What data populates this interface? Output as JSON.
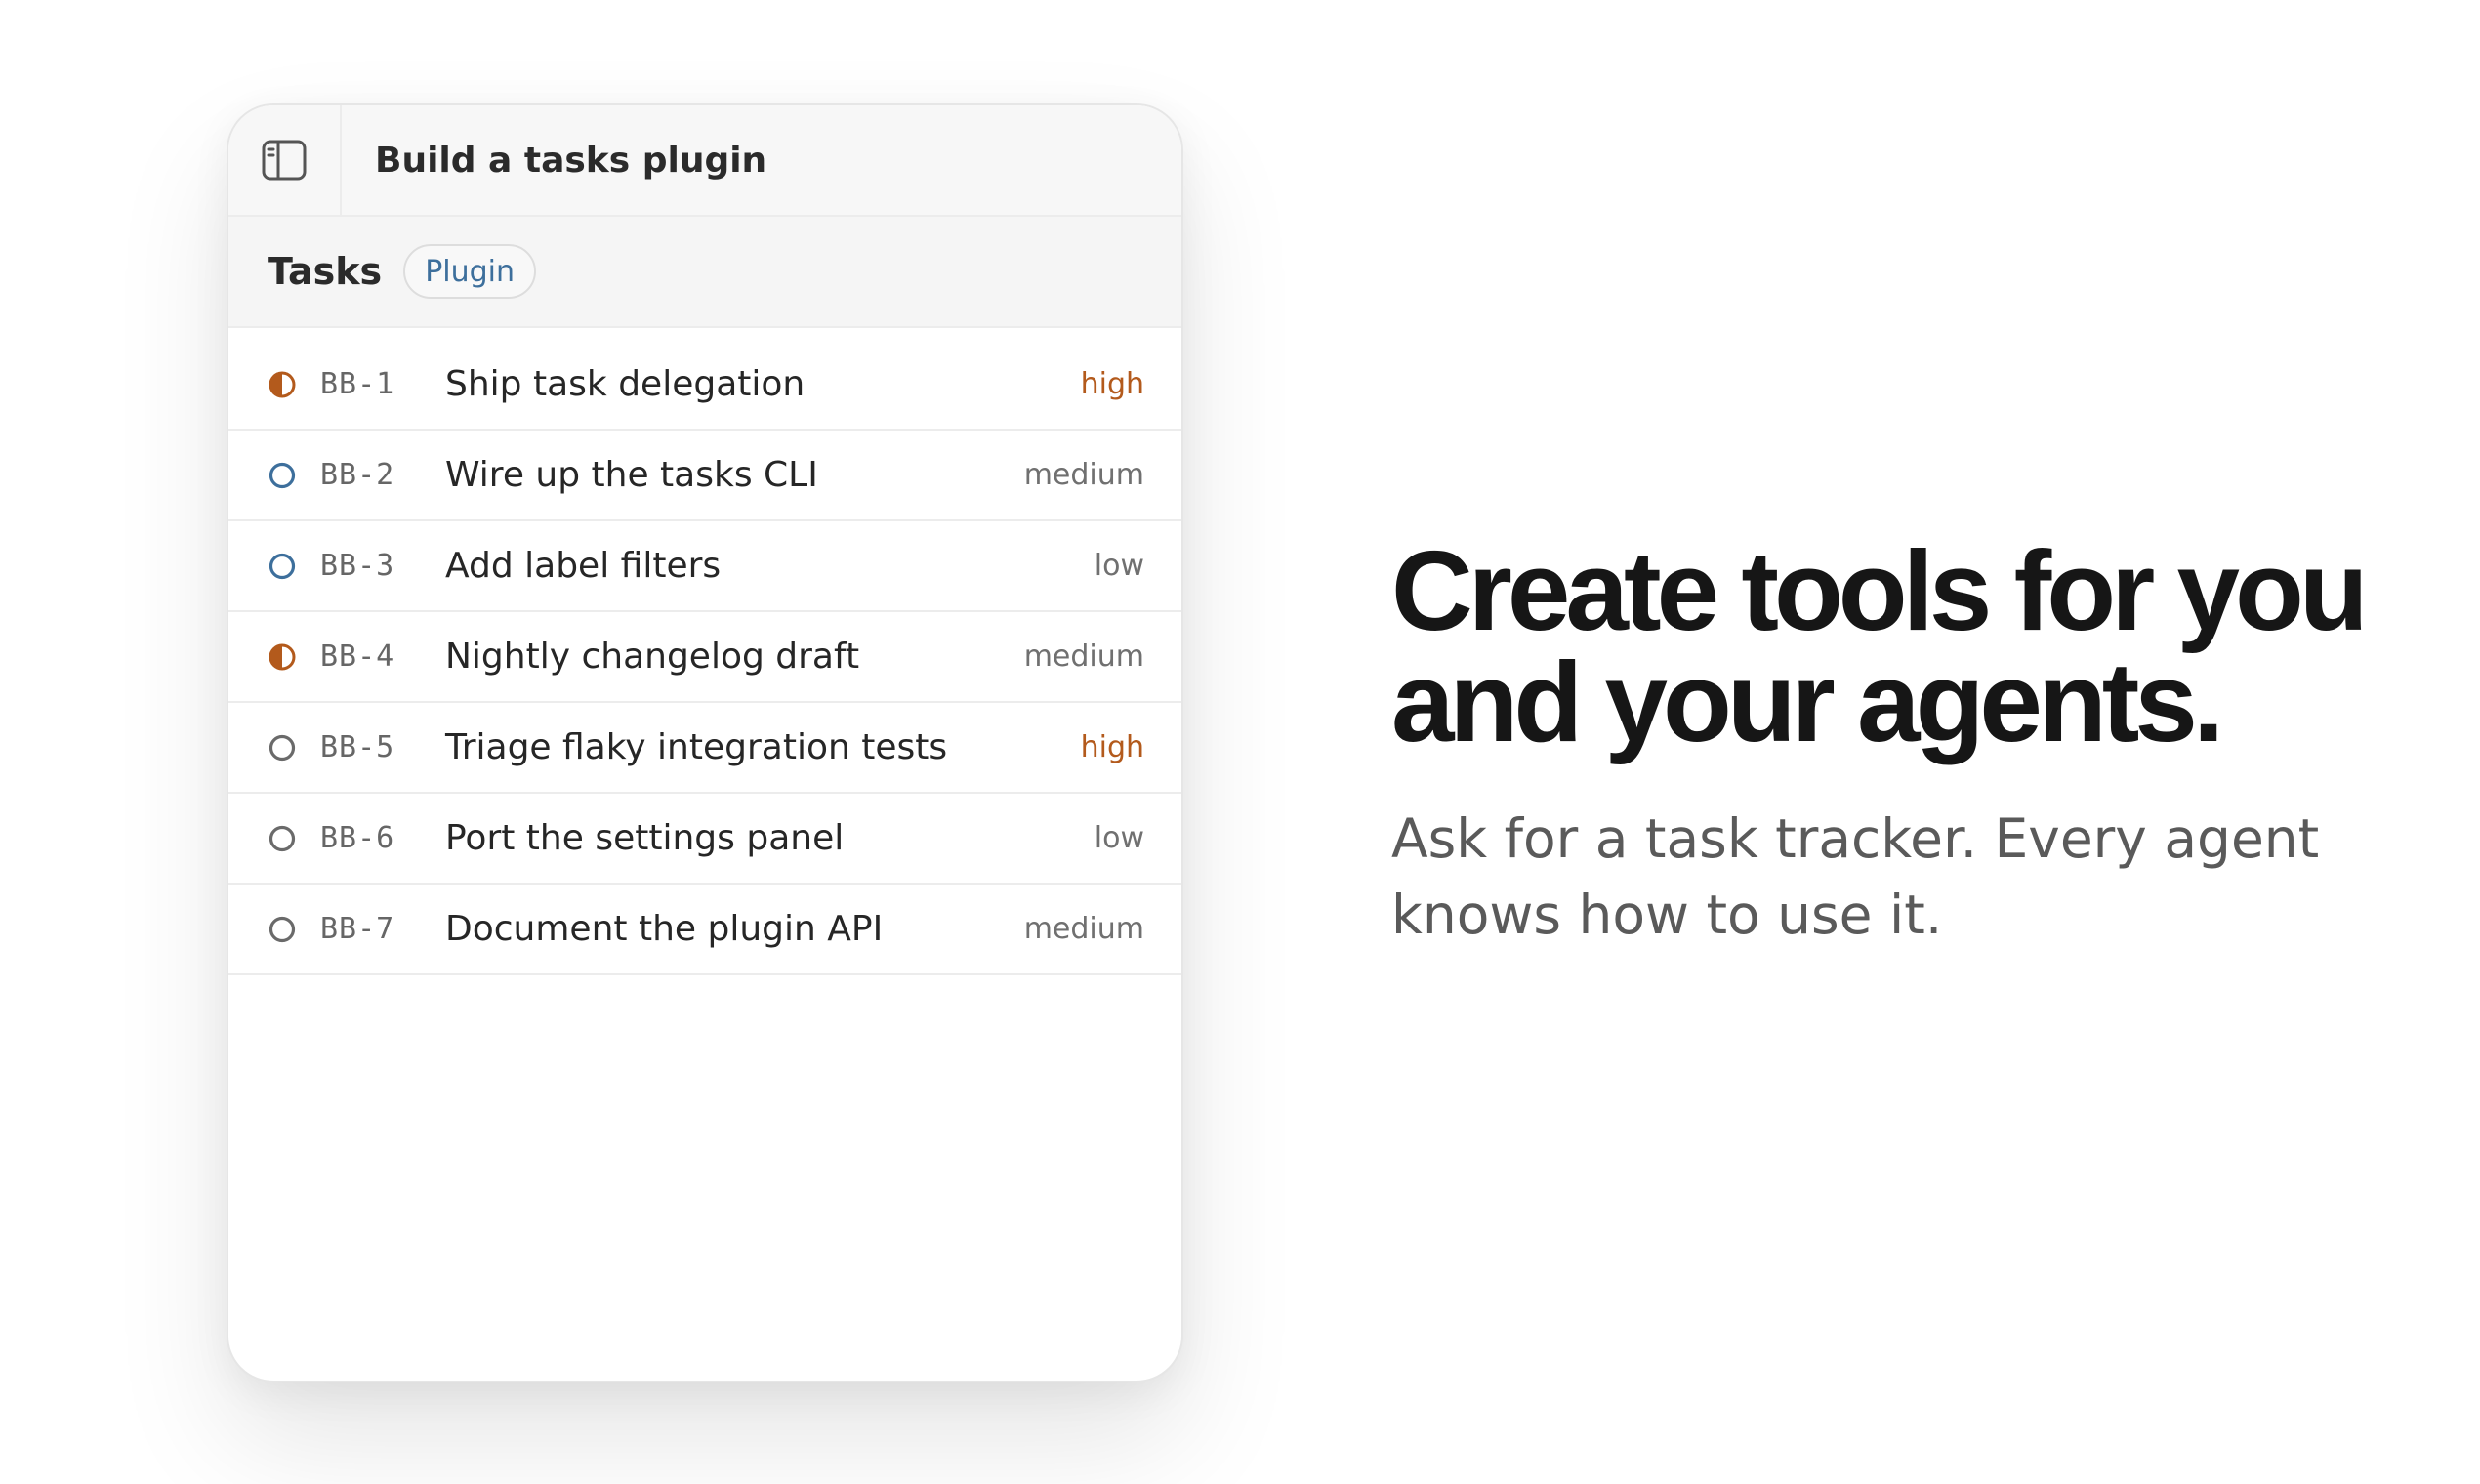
{
  "window": {
    "title": "Build a tasks plugin",
    "sidebar_toggle_icon": "sidebar-panel-icon"
  },
  "tasks": {
    "heading": "Tasks",
    "badge": "Plugin",
    "items": [
      {
        "id": "BB-1",
        "title": "Ship task delegation",
        "priority": "high",
        "status": "in-progress"
      },
      {
        "id": "BB-2",
        "title": "Wire up the tasks CLI",
        "priority": "medium",
        "status": "open-blue"
      },
      {
        "id": "BB-3",
        "title": "Add label filters",
        "priority": "low",
        "status": "open-blue"
      },
      {
        "id": "BB-4",
        "title": "Nightly changelog draft",
        "priority": "medium",
        "status": "in-progress"
      },
      {
        "id": "BB-5",
        "title": "Triage flaky integration tests",
        "priority": "high",
        "status": "open"
      },
      {
        "id": "BB-6",
        "title": "Port the settings panel",
        "priority": "low",
        "status": "open"
      },
      {
        "id": "BB-7",
        "title": "Document the plugin API",
        "priority": "medium",
        "status": "open"
      }
    ]
  },
  "marketing": {
    "headline_line1": "Create tools for you",
    "headline_line2": "and your agents.",
    "subhead_line1": "Ask for a task tracker. Every agent",
    "subhead_line2": "knows how to use it."
  },
  "colors": {
    "in_progress": "#b35a1c",
    "open_blue": "#3d6f9c",
    "open_gray": "#6a6a6a",
    "priority_high": "#b35a1c"
  }
}
